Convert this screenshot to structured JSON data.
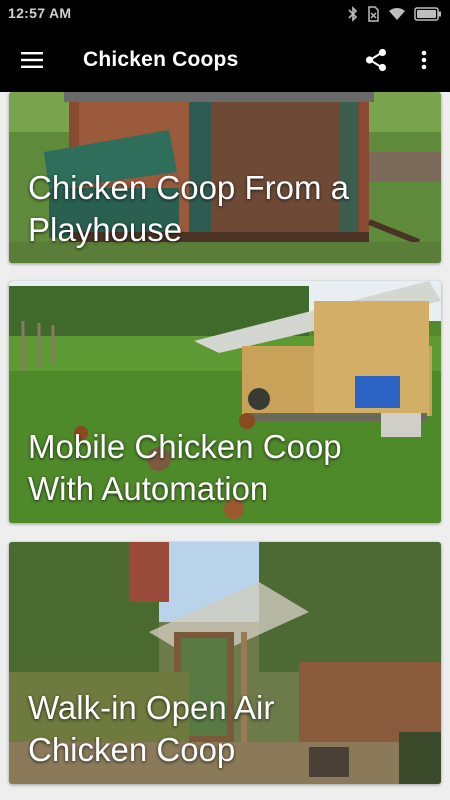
{
  "status_bar": {
    "time": "12:57 AM",
    "icons": [
      "bluetooth-icon",
      "sim-off-icon",
      "wifi-icon",
      "battery-icon"
    ]
  },
  "toolbar": {
    "title": "Chicken Coops",
    "menu_icon": "hamburger-menu-icon",
    "share_icon": "share-icon",
    "overflow_icon": "more-vert-icon"
  },
  "feed": {
    "cards": [
      {
        "title_line1": "Chicken Coop From a",
        "title_line2": "Playhouse"
      },
      {
        "title_line1": "Mobile Chicken Coop",
        "title_line2": "With Automation"
      },
      {
        "title_line1": "Walk-in Open Air",
        "title_line2": "Chicken Coop"
      }
    ]
  },
  "colors": {
    "app_bar": "#000000",
    "background": "#eeeeee",
    "title_text": "#ffffff"
  }
}
